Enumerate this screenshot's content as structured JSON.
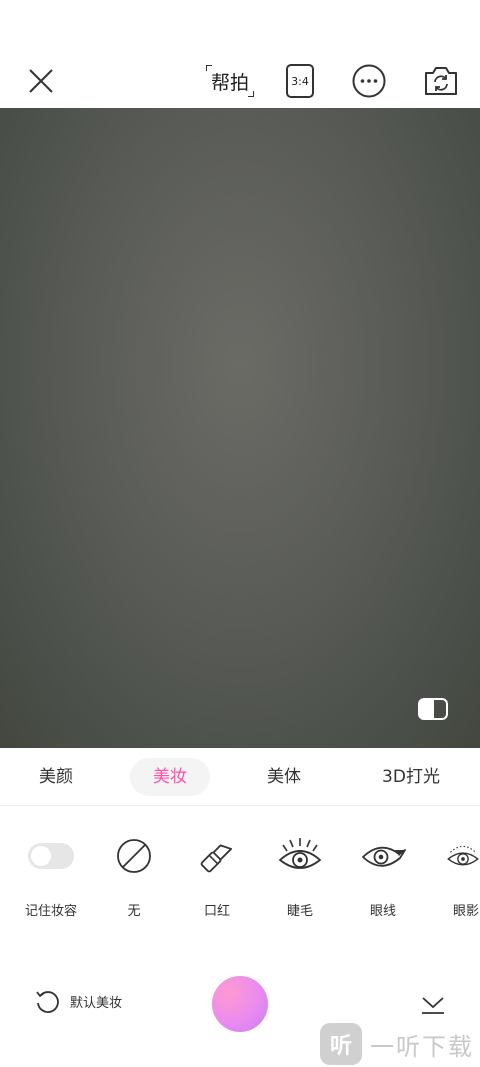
{
  "toolbar": {
    "help_label": "帮拍",
    "ratio_label": "3:4"
  },
  "tabs": [
    {
      "label": "美颜",
      "active": false
    },
    {
      "label": "美妆",
      "active": true
    },
    {
      "label": "美体",
      "active": false
    },
    {
      "label": "3D打光",
      "active": false
    }
  ],
  "makeup_items": [
    {
      "label": "记住妆容",
      "icon": "toggle-switch-icon"
    },
    {
      "label": "无",
      "icon": "none-icon"
    },
    {
      "label": "口红",
      "icon": "lipstick-icon"
    },
    {
      "label": "睫毛",
      "icon": "eyelash-icon"
    },
    {
      "label": "眼线",
      "icon": "eyeliner-icon"
    },
    {
      "label": "眼影",
      "icon": "eyeshadow-icon"
    }
  ],
  "bottom": {
    "reset_label": "默认美妆"
  },
  "watermark": {
    "logo_char": "听",
    "text": "一听下载"
  },
  "colors": {
    "accent": "#ff4fa8",
    "shutter": "#e98bf0"
  }
}
